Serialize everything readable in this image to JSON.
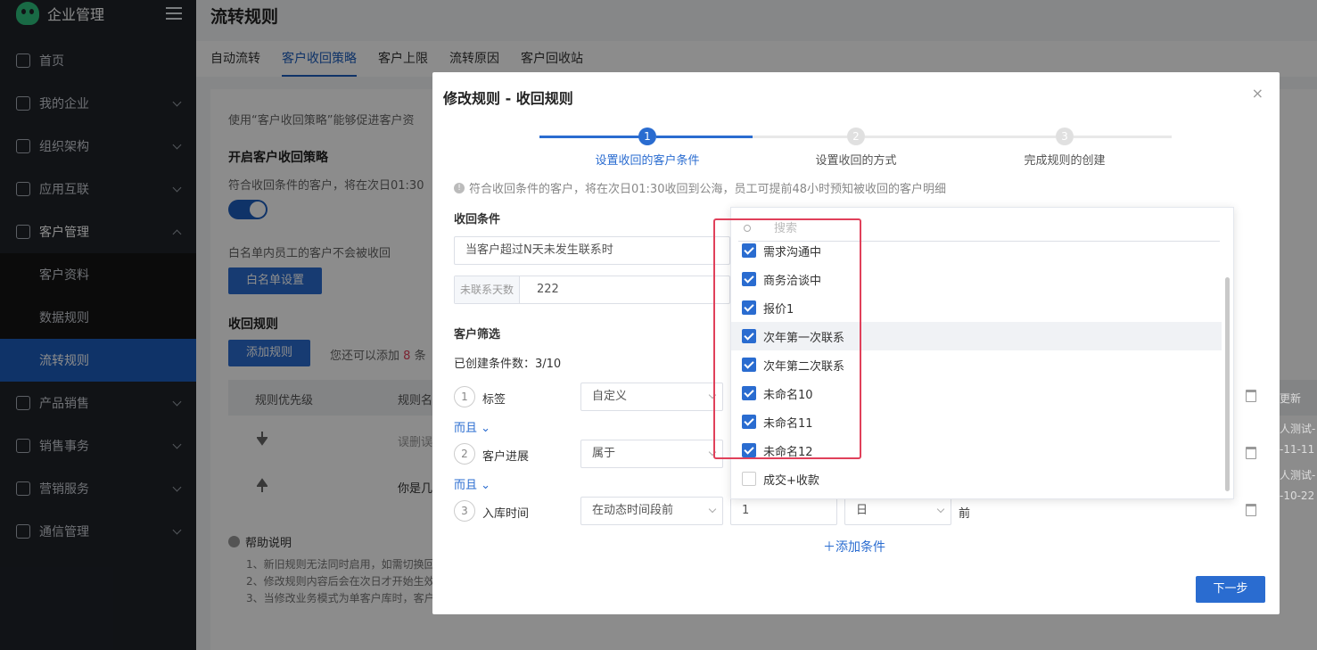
{
  "sidebar": {
    "title": "企业管理",
    "items": [
      {
        "label": "首页",
        "icon": "home-icon"
      },
      {
        "label": "我的企业",
        "icon": "building-icon"
      },
      {
        "label": "组织架构",
        "icon": "org-icon"
      },
      {
        "label": "应用互联",
        "icon": "apps-icon"
      },
      {
        "label": "客户管理",
        "icon": "user-icon"
      },
      {
        "label": "产品销售",
        "icon": "box-icon"
      },
      {
        "label": "销售事务",
        "icon": "layers-icon"
      },
      {
        "label": "营销服务",
        "icon": "service-icon"
      },
      {
        "label": "通信管理",
        "icon": "drive-icon"
      }
    ],
    "sub_items": [
      "客户资料",
      "数据规则",
      "流转规则"
    ]
  },
  "page": {
    "title": "流转规则",
    "tabs": [
      "自动流转",
      "客户收回策略",
      "客户上限",
      "流转原因",
      "客户回收站"
    ],
    "intro": "使用“客户收回策略”能够促进客户资",
    "enable_title": "开启客户收回策略",
    "enable_desc": "符合收回条件的客户，将在次日01:30",
    "whitelist_desc": "白名单内员工的客户不会被收回",
    "whitelist_btn": "白名单设置",
    "rules_title": "收回规则",
    "add_rule_btn": "添加规则",
    "add_hint_a": "您还可以添加",
    "add_hint_num": "8",
    "add_hint_b": "条",
    "col_priority": "规则优先级",
    "col_name": "规则名",
    "col_update": "更新",
    "row1_name": "误删误",
    "row2_name": "你是几",
    "row1_right_a": "人测试-",
    "row1_right_b": "-11-11",
    "row2_right_a": "人测试-",
    "row2_right_b": "-10-22",
    "help_title": "帮助说明",
    "help_1": "1、新旧规则无法同时启用，如需切换回",
    "help_2": "2、修改规则内容后会在次日才开始生效",
    "help_3": "3、当修改业务模式为单客户库时，客户"
  },
  "modal": {
    "title": "修改规则 - 收回规则",
    "close": "×",
    "steps": [
      {
        "num": "1",
        "label": "设置收回的客户条件"
      },
      {
        "num": "2",
        "label": "设置收回的方式"
      },
      {
        "num": "3",
        "label": "完成规则的创建"
      }
    ],
    "tip_icon": "!",
    "tip": "符合收回条件的客户，将在次日01:30收回到公海，员工可提前48小时预知被收回的客户明细",
    "cond_title": "收回条件",
    "cond_select": "当客户超过N天未发生联系时",
    "days_addon": "未联系天数",
    "days_value": "222",
    "filter_title": "客户筛选",
    "created_count": "已创建条件数：3/10",
    "conditions": [
      {
        "num": "1",
        "field": "标签",
        "op": "自定义"
      },
      {
        "num": "2",
        "field": "客户进展",
        "op": "属于"
      },
      {
        "num": "3",
        "field": "入库时间",
        "op": "在动态时间段前",
        "value": "1",
        "unit": "日",
        "suffix": "前"
      }
    ],
    "and_link": "而且",
    "add_condition": "添加条件",
    "next_btn": "下一步"
  },
  "dropdown": {
    "search_placeholder": "搜索",
    "options": [
      {
        "label": "需求沟通中",
        "checked": true
      },
      {
        "label": "商务洽谈中",
        "checked": true
      },
      {
        "label": "报价1",
        "checked": true
      },
      {
        "label": "次年第一次联系",
        "checked": true
      },
      {
        "label": "次年第二次联系",
        "checked": true
      },
      {
        "label": "未命名10",
        "checked": true
      },
      {
        "label": "未命名11",
        "checked": true
      },
      {
        "label": "未命名12",
        "checked": true
      },
      {
        "label": "成交+收款",
        "checked": false
      }
    ]
  },
  "colors": {
    "accent": "#2a6cd0",
    "sidebar_bg": "#1f2329",
    "highlight": "#e0405a"
  }
}
